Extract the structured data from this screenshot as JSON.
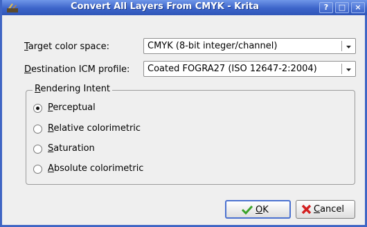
{
  "window": {
    "title": "Convert All Layers From CMYK - Krita",
    "help_label": "?",
    "maximize_label": "□",
    "close_label": "×"
  },
  "target": {
    "label_mnemonic": "T",
    "label_rest": "arget color space:",
    "value": "CMYK (8-bit integer/channel)"
  },
  "destination": {
    "label_mnemonic": "D",
    "label_rest": "estination ICM profile:",
    "value": "Coated FOGRA27 (ISO 12647-2:2004)"
  },
  "rendering": {
    "title_mnemonic": "R",
    "title_rest": "endering Intent",
    "options": [
      {
        "mnemonic": "P",
        "rest": "erceptual",
        "selected": true
      },
      {
        "mnemonic": "R",
        "rest": "elative colorimetric",
        "selected": false
      },
      {
        "mnemonic": "S",
        "rest": "aturation",
        "selected": false
      },
      {
        "mnemonic": "A",
        "rest": "bsolute colorimetric",
        "selected": false
      }
    ]
  },
  "buttons": {
    "ok_mnemonic": "O",
    "ok_rest": "K",
    "cancel_mnemonic": "C",
    "cancel_rest": "ancel"
  },
  "colors": {
    "titlebar": "#3c64c9",
    "ok_check": "#3aa32a",
    "cancel_x": "#d32020"
  }
}
